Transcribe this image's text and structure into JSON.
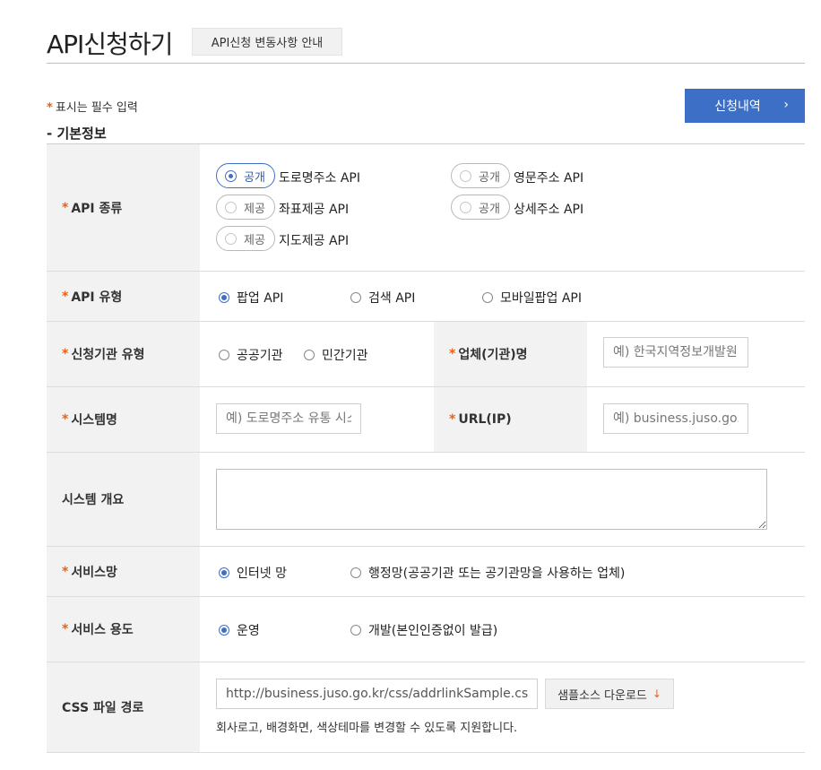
{
  "header": {
    "title": "API신청하기",
    "notice_button": "API신청 변동사항 안내"
  },
  "required_note": "표시는 필수 입력",
  "section_title": "- 기본정보",
  "history_button": {
    "label": "신청내역",
    "chevron": "›"
  },
  "required_mark": "*",
  "rows": {
    "api_kind": {
      "label": "API 종류",
      "options": [
        {
          "badge": "공개",
          "name": "도로명주소 API",
          "selected": true
        },
        {
          "badge": "공개",
          "name": "영문주소 API",
          "selected": false
        },
        {
          "badge": "제공",
          "name": "좌표제공 API",
          "selected": false
        },
        {
          "badge": "공개",
          "name": "상세주소 API",
          "selected": false
        },
        {
          "badge": "제공",
          "name": "지도제공 API",
          "selected": false
        }
      ]
    },
    "api_type": {
      "label": "API 유형",
      "options": [
        "팝업 API",
        "검색 API",
        "모바일팝업 API"
      ],
      "selected": 0
    },
    "org_type": {
      "label": "신청기관 유형",
      "options": [
        "공공기관",
        "민간기관"
      ],
      "company_label": "업체(기관)명",
      "company_placeholder": "예) 한국지역정보개발원"
    },
    "system": {
      "label": "시스템명",
      "placeholder": "예) 도로명주소 유통 시스템",
      "url_label": "URL(IP)",
      "url_placeholder": "예) business.juso.go.kr"
    },
    "system_overview": {
      "label": "시스템 개요"
    },
    "service_network": {
      "label": "서비스망",
      "options": [
        "인터넷 망",
        "행정망(공공기관 또는 공기관망을 사용하는 업체)"
      ],
      "selected": 0
    },
    "service_purpose": {
      "label": "서비스 용도",
      "options": [
        "운영",
        "개발(본인인증없이 발급)"
      ],
      "selected": 0
    },
    "css_path": {
      "label": "CSS 파일 경로",
      "value": "http://business.juso.go.kr/css/addrlinkSample.css",
      "download_button": "샘플소스 다운로드",
      "download_icon": "↓",
      "helper": "회사로고, 배경화면, 색상테마를 변경할 수 있도록 지원합니다."
    }
  },
  "colors": {
    "accent": "#3e6fc6",
    "required": "#e0641e",
    "label_bg": "#f2f2f2"
  }
}
